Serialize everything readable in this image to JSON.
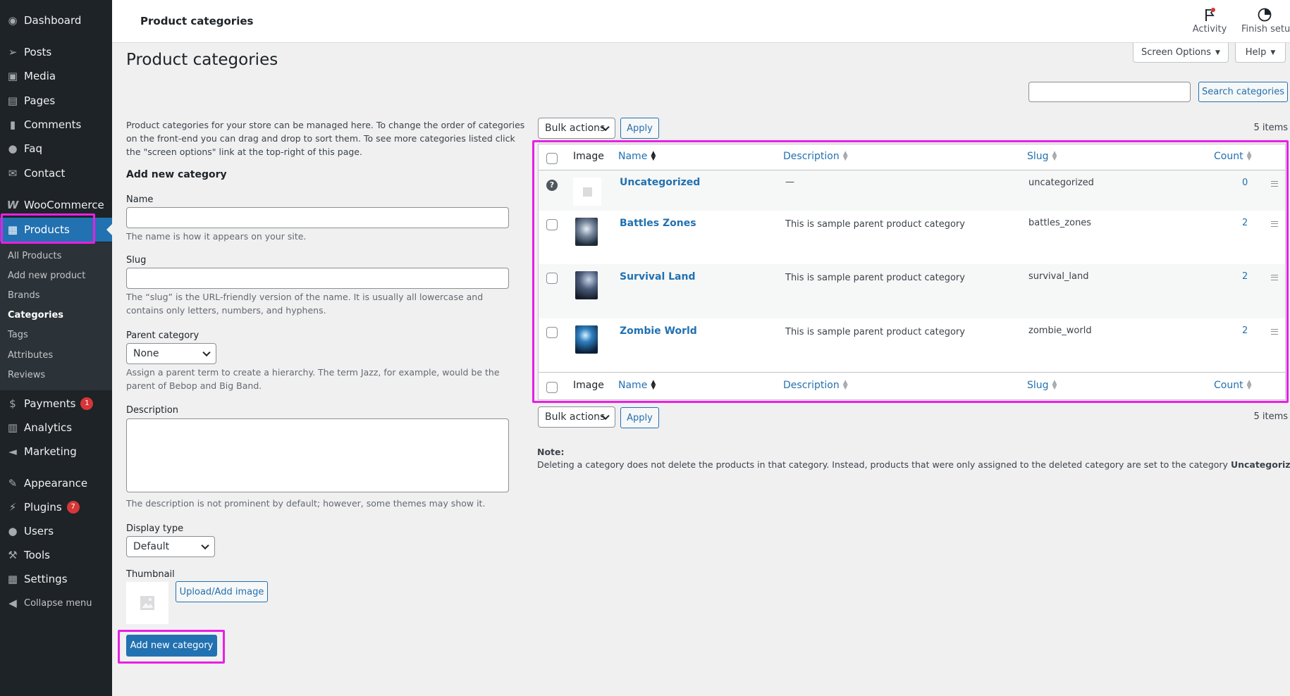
{
  "sidebar": {
    "items": [
      {
        "label": "Dashboard",
        "icon": "dashboard-icon"
      },
      {
        "label": "Posts",
        "icon": "pin-icon"
      },
      {
        "label": "Media",
        "icon": "media-icon"
      },
      {
        "label": "Pages",
        "icon": "pages-icon"
      },
      {
        "label": "Comments",
        "icon": "comment-icon"
      },
      {
        "label": "Faq",
        "icon": "user-icon"
      },
      {
        "label": "Contact",
        "icon": "envelope-icon"
      },
      {
        "label": "WooCommerce",
        "icon": "woo-icon"
      },
      {
        "label": "Products",
        "icon": "archive-icon"
      },
      {
        "label": "Payments",
        "icon": "dollar-icon",
        "badge": "1"
      },
      {
        "label": "Analytics",
        "icon": "chart-bar-icon"
      },
      {
        "label": "Marketing",
        "icon": "megaphone-icon"
      },
      {
        "label": "Appearance",
        "icon": "brush-icon"
      },
      {
        "label": "Plugins",
        "icon": "plug-icon",
        "badge": "7"
      },
      {
        "label": "Users",
        "icon": "users-icon"
      },
      {
        "label": "Tools",
        "icon": "wrench-icon"
      },
      {
        "label": "Settings",
        "icon": "settings-icon"
      },
      {
        "label": "Collapse menu",
        "icon": "collapse-icon"
      }
    ],
    "submenu": [
      "All Products",
      "Add new product",
      "Brands",
      "Categories",
      "Tags",
      "Attributes",
      "Reviews"
    ]
  },
  "topbar": {
    "title": "Product categories",
    "activity_label": "Activity",
    "finish_setup_label": "Finish setup"
  },
  "screen_options_label": "Screen Options",
  "help_label": "Help",
  "page_heading": "Product categories",
  "search": {
    "button_label": "Search categories",
    "value": ""
  },
  "form": {
    "intro": "Product categories for your store can be managed here. To change the order of categories on the front-end you can drag and drop to sort them. To see more categories listed click the \"screen options\" link at the top-right of this page.",
    "heading": "Add new category",
    "name_label": "Name",
    "name_help": "The name is how it appears on your site.",
    "slug_label": "Slug",
    "slug_help": "The “slug” is the URL-friendly version of the name. It is usually all lowercase and contains only letters, numbers, and hyphens.",
    "parent_label": "Parent category",
    "parent_value": "None",
    "parent_help": "Assign a parent term to create a hierarchy. The term Jazz, for example, would be the parent of Bebop and Big Band.",
    "description_label": "Description",
    "description_help": "The description is not prominent by default; however, some themes may show it.",
    "display_type_label": "Display type",
    "display_type_value": "Default",
    "thumbnail_label": "Thumbnail",
    "upload_label": "Upload/Add image",
    "submit_label": "Add new category"
  },
  "bulk": {
    "label": "Bulk actions",
    "apply_label": "Apply",
    "items_count": "5 items"
  },
  "table": {
    "columns": {
      "image": "Image",
      "name": "Name",
      "description": "Description",
      "slug": "Slug",
      "count": "Count"
    },
    "rows": [
      {
        "name": "Uncategorized",
        "description": "—",
        "slug": "uncategorized",
        "count": "0"
      },
      {
        "name": "Battles Zones",
        "description": "This is sample parent product category",
        "slug": "battles_zones",
        "count": "2"
      },
      {
        "name": "Survival Land",
        "description": "This is sample parent product category",
        "slug": "survival_land",
        "count": "2"
      },
      {
        "name": "Zombie World",
        "description": "This is sample parent product category",
        "slug": "zombie_world",
        "count": "2"
      }
    ]
  },
  "note": {
    "label": "Note:",
    "text": "Deleting a category does not delete the products in that category. Instead, products that were only assigned to the deleted category are set to the category",
    "bold": "Uncategorized",
    "end": "."
  },
  "colors": {
    "admin_blue": "#2271b1",
    "sidebar_bg": "#1d2327",
    "highlight": "#e91fe3",
    "badge_red": "#d63638"
  }
}
